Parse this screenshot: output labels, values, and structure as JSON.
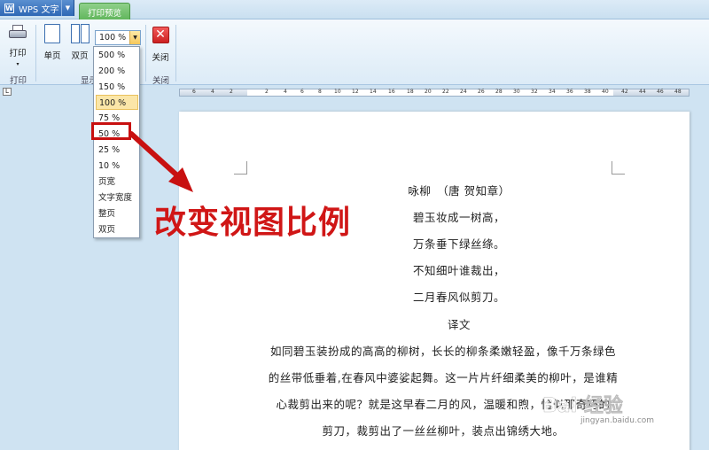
{
  "titlebar": {
    "app_name": "WPS 文字",
    "app_logo": "W",
    "active_tab": "打印预览"
  },
  "ribbon": {
    "print_label": "打印",
    "single_page_label": "单页",
    "double_page_label": "双页",
    "close_label": "关闭",
    "group_print": "打印",
    "group_display": "显示",
    "group_close": "关闭"
  },
  "zoom": {
    "current": "100 %",
    "options": [
      "500 %",
      "200 %",
      "150 %",
      "100 %",
      "75 %",
      "50 %",
      "25 %",
      "10 %",
      "页宽",
      "文字宽度",
      "整页",
      "双页"
    ],
    "selected": "100 %",
    "highlighted": "50 %"
  },
  "ruler": {
    "ticks": [
      "6",
      "4",
      "2",
      "2",
      "4",
      "6",
      "8",
      "10",
      "12",
      "14",
      "16",
      "18",
      "20",
      "22",
      "24",
      "26",
      "28",
      "30",
      "32",
      "34",
      "36",
      "38",
      "40",
      "42",
      "44",
      "46",
      "48"
    ]
  },
  "annotation": {
    "text": "改变视图比例",
    "color": "#d01616"
  },
  "document": {
    "title": "咏柳　（唐 贺知章）",
    "lines": [
      "碧玉妆成一树高，",
      "万条垂下绿丝绦。",
      "不知细叶谁裁出，",
      "二月春风似剪刀。"
    ],
    "translation_heading": "译文",
    "translation": [
      "如同碧玉装扮成的高高的柳树，长长的柳条柔嫩轻盈，像千万条绿色",
      "的丝带低垂着,在春风中婆娑起舞。这一片片纤细柔美的柳叶，是谁精",
      "心裁剪出来的呢？就是这早春二月的风，温暖和煦，恰似那奇巧的",
      "剪刀，裁剪出了一丝丝柳叶，装点出锦绣大地。"
    ]
  },
  "watermark": {
    "text": "Bai 经验",
    "sub": "jingyan.baidu.com"
  },
  "colors": {
    "accent_red": "#d01616",
    "tab_green": "#5fb55a",
    "app_blue": "#2f68b5"
  }
}
